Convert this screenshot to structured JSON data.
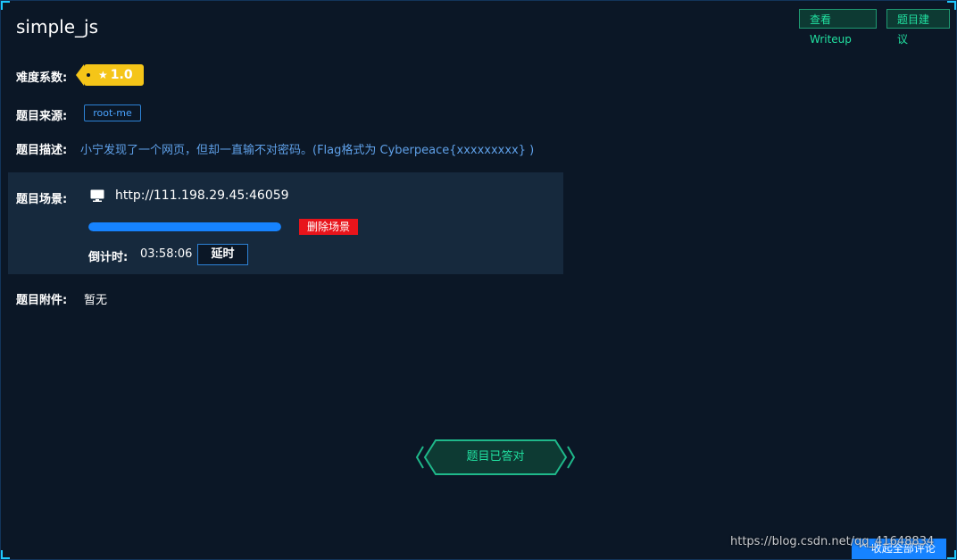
{
  "challenge": {
    "title": "simple_js"
  },
  "toolbar": {
    "writeup_label": "查看Writeup",
    "suggest_label": "题目建议"
  },
  "difficulty": {
    "label": "难度系数:",
    "value": "1.0",
    "tag_color": "#f5c518"
  },
  "source": {
    "label": "题目来源:",
    "value": "root-me"
  },
  "description": {
    "label": "题目描述:",
    "text": "小宁发现了一个网页，但却一直输不对密码。(Flag格式为 Cyberpeace{xxxxxxxxx} )"
  },
  "scene": {
    "label": "题目场景:",
    "url": "http://111.198.29.45:46059",
    "progress": 1.0,
    "delete_label": "删除场景",
    "countdown_label": "倒计时:",
    "countdown_value": "03:58:06",
    "extend_label": "延时"
  },
  "attachment": {
    "label": "题目附件:",
    "value": "暂无"
  },
  "status": {
    "answered_label": "题目已答对",
    "accent_color": "#21e0a0"
  },
  "footer": {
    "watermark": "https://blog.csdn.net/qq_41648834",
    "collapse_label": "^ 收起全部评论"
  },
  "icons": {
    "difficulty": "star-icon",
    "scene": "monitor-icon"
  }
}
